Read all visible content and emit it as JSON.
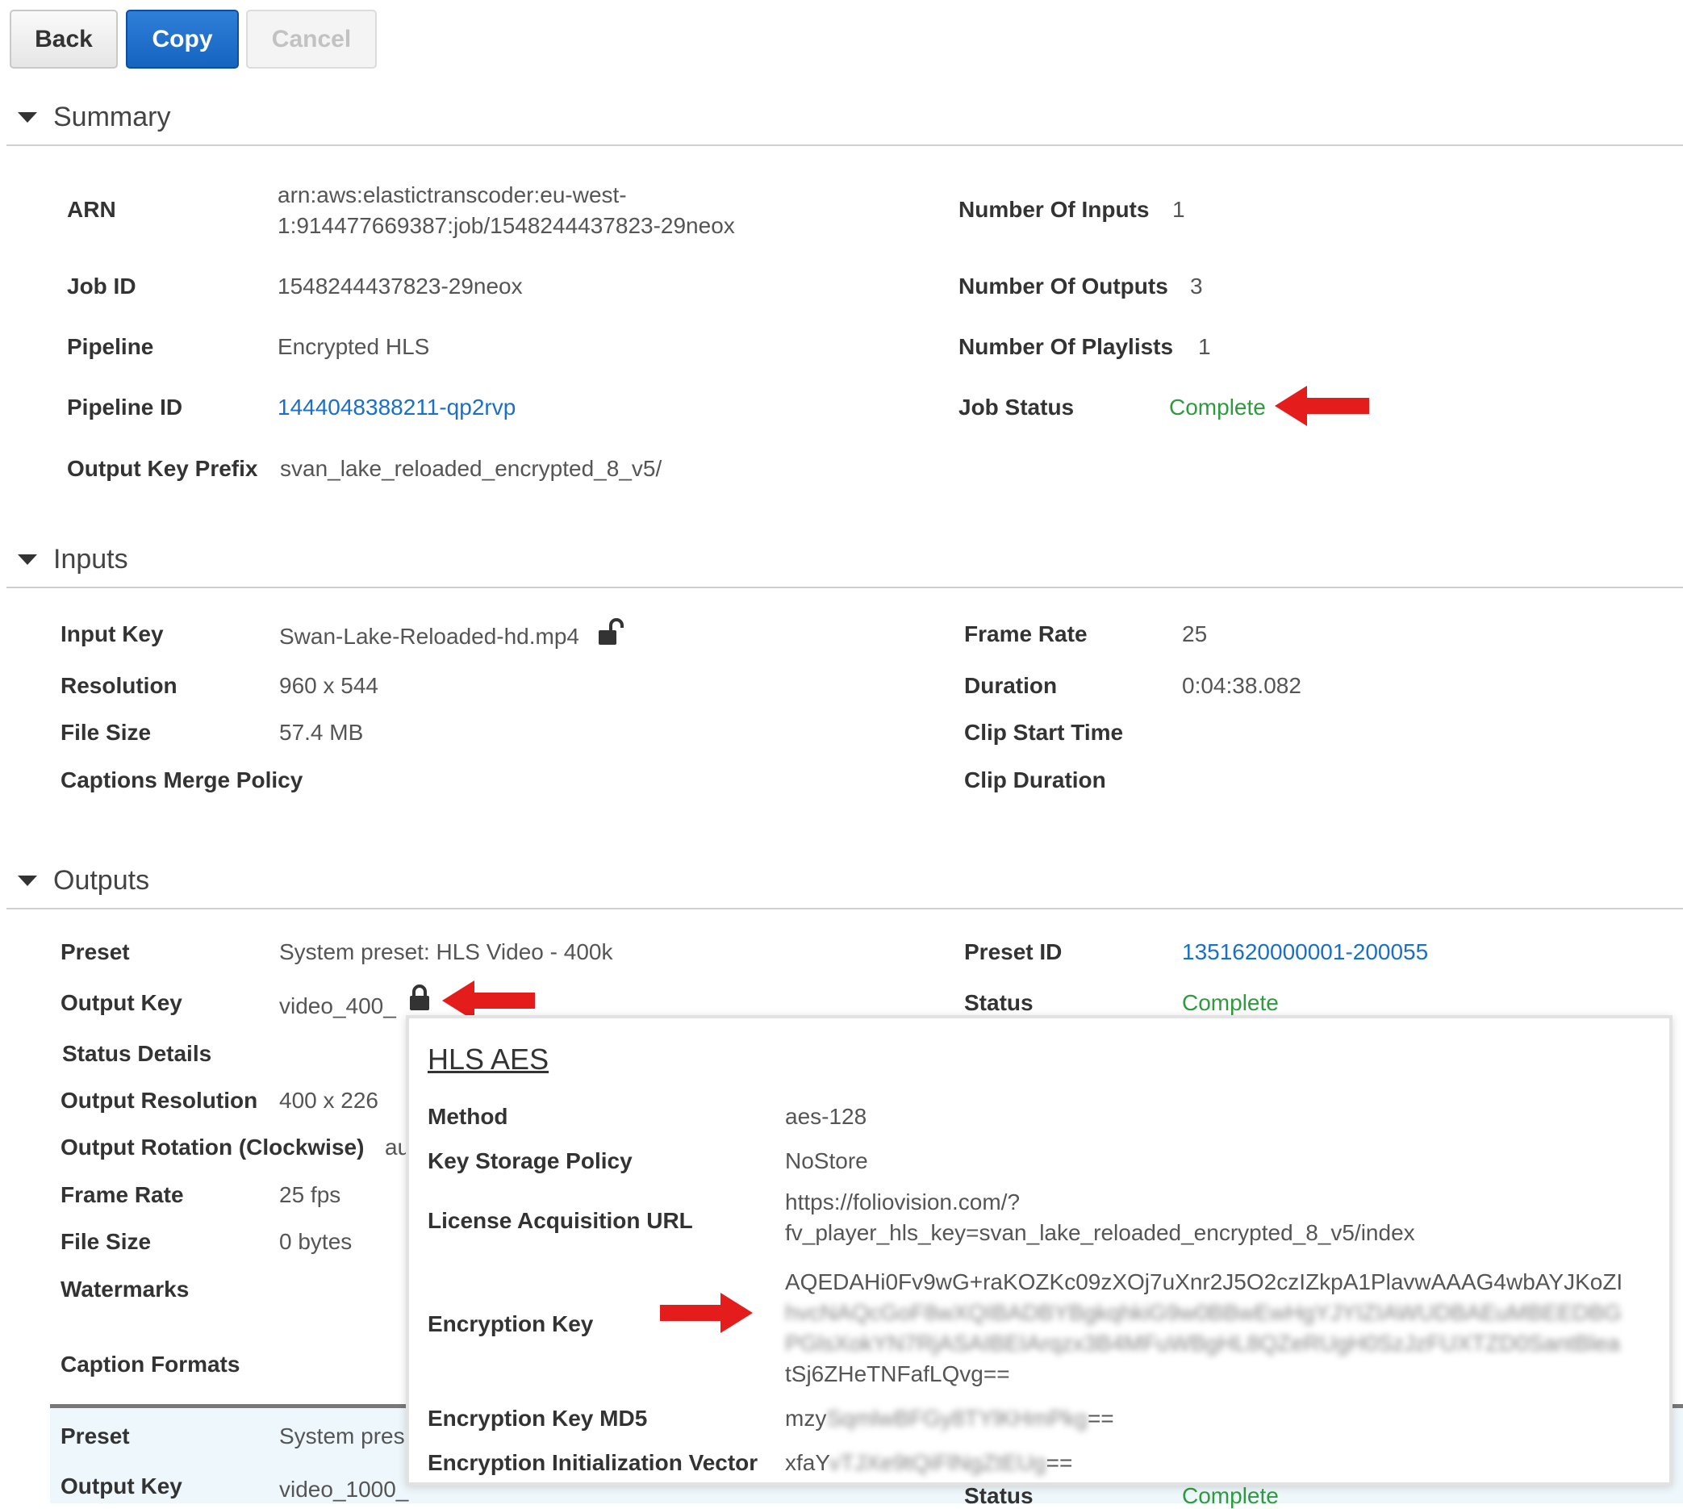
{
  "toolbar": {
    "back": "Back",
    "copy": "Copy",
    "cancel": "Cancel"
  },
  "summary": {
    "heading": "Summary",
    "arn_label": "ARN",
    "arn_line1": "arn:aws:elastictranscoder:eu-west-",
    "arn_line2": "1:914477669387:job/1548244437823-29neox",
    "job_id_label": "Job ID",
    "job_id": "1548244437823-29neox",
    "pipeline_label": "Pipeline",
    "pipeline": "Encrypted HLS",
    "pipeline_id_label": "Pipeline ID",
    "pipeline_id": "1444048388211-qp2rvp",
    "output_key_prefix_label": "Output Key Prefix",
    "output_key_prefix": "svan_lake_reloaded_encrypted_8_v5/",
    "num_inputs_label": "Number Of Inputs",
    "num_inputs": "1",
    "num_outputs_label": "Number Of Outputs",
    "num_outputs": "3",
    "num_playlists_label": "Number Of Playlists",
    "num_playlists": "1",
    "job_status_label": "Job Status",
    "job_status": "Complete"
  },
  "inputs": {
    "heading": "Inputs",
    "input_key_label": "Input Key",
    "input_key": "Swan-Lake-Reloaded-hd.mp4",
    "resolution_label": "Resolution",
    "resolution": "960 x 544",
    "file_size_label": "File Size",
    "file_size": "57.4 MB",
    "captions_merge_label": "Captions Merge Policy",
    "frame_rate_label": "Frame Rate",
    "frame_rate": "25",
    "duration_label": "Duration",
    "duration": "0:04:38.082",
    "clip_start_label": "Clip Start Time",
    "clip_duration_label": "Clip Duration"
  },
  "outputs": {
    "heading": "Outputs",
    "preset_label": "Preset",
    "preset": "System preset: HLS Video - 400k",
    "output_key_label": "Output Key",
    "output_key": "video_400_",
    "status_details_label": "Status Details",
    "output_resolution_label": "Output Resolution",
    "output_resolution": "400 x 226",
    "output_rotation_label": "Output Rotation (Clockwise)",
    "output_rotation_partial": "au",
    "frame_rate_label": "Frame Rate",
    "frame_rate": "25 fps",
    "file_size_label": "File Size",
    "file_size": "0 bytes",
    "watermarks_label": "Watermarks",
    "caption_formats_label": "Caption Formats",
    "preset_id_label": "Preset ID",
    "preset_id": "1351620000001-200055",
    "status_label": "Status",
    "status": "Complete",
    "second": {
      "preset_label": "Preset",
      "preset_partial": "System pres",
      "output_key_label": "Output Key",
      "output_key_partial": "video_1000_",
      "status_label_partial": "Status",
      "status_partial": "Complete"
    }
  },
  "popup": {
    "title": "HLS AES",
    "method_label": "Method",
    "method": "aes-128",
    "key_storage_label": "Key Storage Policy",
    "key_storage": "NoStore",
    "license_url_label": "License Acquisition URL",
    "license_url_line1": "https://foliovision.com/?",
    "license_url_line2": "fv_player_hls_key=svan_lake_reloaded_encrypted_8_v5/index",
    "enc_key_label": "Encryption Key",
    "enc_key_line1": "AQEDAHi0Fv9wG+raKOZKc09zXOj7uXnr2J5O2czIZkpA1PlavwAAAG4wbAYJKoZI",
    "enc_key_line2_blurred": "hvcNAQcGoF8wXQIBADBYBgkqhkiG9w0BBwEwHgYJYIZIAWUDBAEuMBEEDBG",
    "enc_key_line3_blurred": "PGlsXokYN7RjASAIBEIArqzx3B4MFuWBgHL8QZeRUgH0SzJzFUXTZD0SantBlea",
    "enc_key_line4": "tSj6ZHeTNFafLQvg==",
    "enc_key_md5_label": "Encryption Key MD5",
    "enc_key_md5_visible": "mzy",
    "enc_key_md5_blurred": "SqmlwBFGy8TYlKHmPkg",
    "enc_key_md5_tail": "==",
    "enc_iv_label": "Encryption Initialization Vector",
    "enc_iv_visible": "xfaY",
    "enc_iv_blurred": "vTJXe9tQiFlNgZtEUg",
    "enc_iv_tail": "=="
  },
  "colors": {
    "accent": "#1565c0",
    "link": "#1a6fc8",
    "success": "#2e9b3e",
    "arrow": "#e51c1c"
  },
  "icons": [
    "lock-open-icon",
    "lock-icon",
    "triangle-down-icon",
    "red-arrow"
  ]
}
